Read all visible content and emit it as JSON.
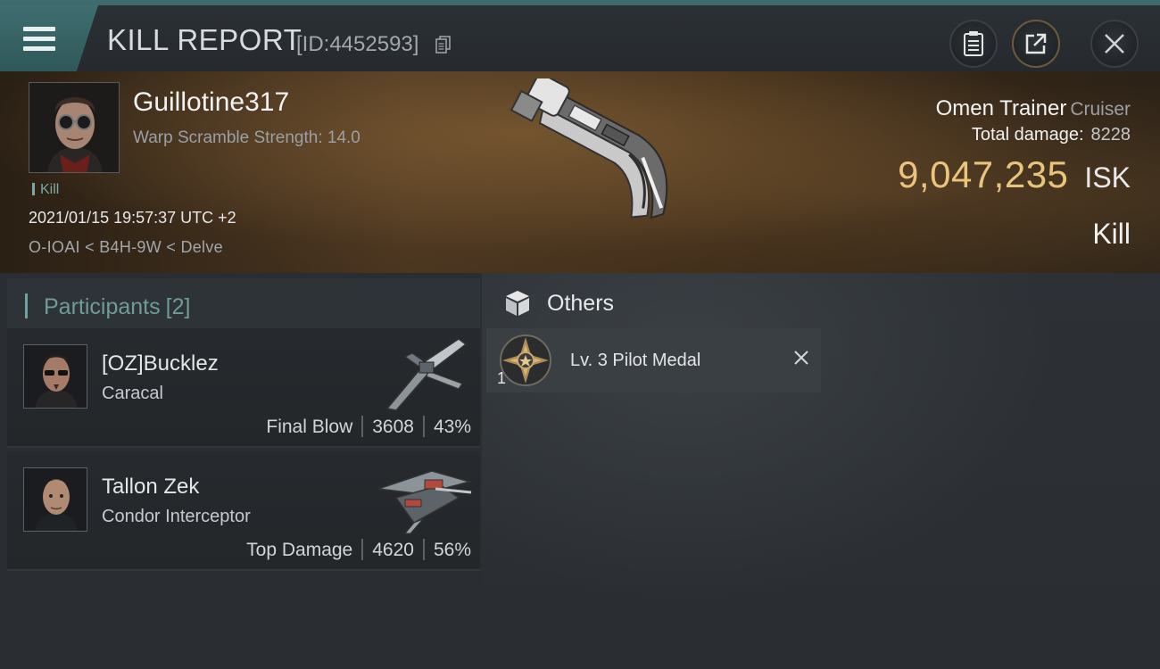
{
  "header": {
    "title": "KILL REPORT",
    "report_id": "[ID:4452593]"
  },
  "victim": {
    "name": "Guillotine317",
    "warp_scramble": "Warp Scramble Strength: 14.0",
    "tag": "Kill",
    "timestamp": "2021/01/15 19:57:37 UTC +2",
    "location": "O-IOAI < B4H-9W < Delve",
    "ship_name": "Omen Trainer",
    "ship_class": "Cruiser",
    "total_damage_label": "Total damage:",
    "total_damage": "8228",
    "isk_value": "9,047,235",
    "isk_unit": "ISK",
    "result": "Kill"
  },
  "participants": {
    "title": "Participants",
    "count": "[2]",
    "items": [
      {
        "name": "[OZ]Bucklez",
        "ship": "Caracal",
        "role": "Final Blow",
        "damage": "3608",
        "percent": "43%"
      },
      {
        "name": "Tallon Zek",
        "ship": "Condor Interceptor",
        "role": "Top Damage",
        "damage": "4620",
        "percent": "56%"
      }
    ]
  },
  "others": {
    "title": "Others",
    "items": [
      {
        "name": "Lv. 3 Pilot Medal",
        "quantity": "1"
      }
    ]
  },
  "colors": {
    "accent": "#3d6b6e",
    "isk": "#e8c47c",
    "participants_title": "#6f9b99"
  }
}
